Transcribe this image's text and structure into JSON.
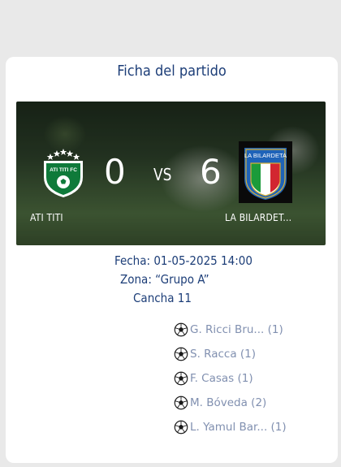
{
  "panel": {
    "title": "Ficha del partido"
  },
  "match": {
    "home": {
      "name": "ATI TITI",
      "crest_text": "ATI TITI FC",
      "score": "0"
    },
    "away": {
      "name": "LA BILARDET...",
      "crest_text": "LA BILARDETA",
      "score": "6"
    },
    "vs_label": "VS",
    "date_line": "Fecha: 01-05-2025 14:00",
    "zone_line": "Zona: “Grupo A”",
    "field_line": "Cancha 11"
  },
  "scorers": [
    {
      "icon": "soccer-ball-icon",
      "text": "G. Ricci Bru... (1)"
    },
    {
      "icon": "soccer-ball-icon",
      "text": "S. Racca (1)"
    },
    {
      "icon": "soccer-ball-icon",
      "text": "F. Casas (1)"
    },
    {
      "icon": "soccer-ball-icon",
      "text": "M. Bóveda  (2)"
    },
    {
      "icon": "soccer-ball-icon",
      "text": "L. Yamul Bar... (1)"
    }
  ],
  "colors": {
    "title": "#1d3e78",
    "scorer_text": "#8190b0",
    "home_crest": "#0f7a3a",
    "card": "#ffffff",
    "background": "#e9e9e9"
  }
}
